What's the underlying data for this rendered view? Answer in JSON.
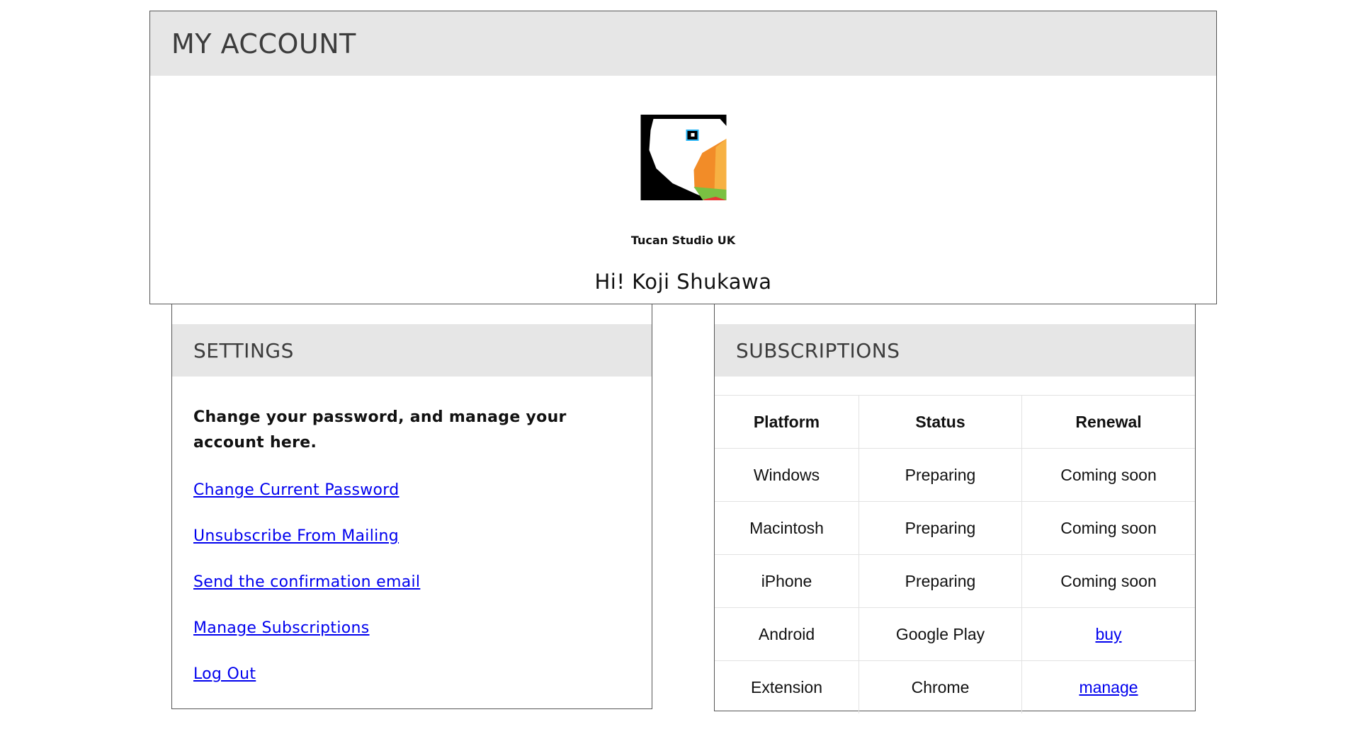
{
  "account": {
    "title": "MY ACCOUNT",
    "company_name": "Tucan Studio UK",
    "greeting": "Hi! Koji Shukawa",
    "logo_icon": "toucan-logo-icon"
  },
  "settings": {
    "title": "SETTINGS",
    "description": "Change your password, and manage your account here.",
    "links": [
      "Change Current Password",
      "Unsubscribe From Mailing",
      "Send the confirmation email",
      "Manage Subscriptions",
      "Log Out"
    ]
  },
  "subscriptions": {
    "title": "SUBSCRIPTIONS",
    "columns": [
      "Platform",
      "Status",
      "Renewal"
    ],
    "rows": [
      [
        "Windows",
        "Preparing",
        "Coming soon"
      ],
      [
        "Macintosh",
        "Preparing",
        "Coming soon"
      ],
      [
        "iPhone",
        "Preparing",
        "Coming soon"
      ],
      [
        "Android",
        "Google Play",
        "buy"
      ],
      [
        "Extension",
        "Chrome",
        "manage"
      ]
    ]
  },
  "colors": {
    "header_bg": "#e6e6e6",
    "header_text": "#3c3c3c",
    "link": "#0000ee",
    "border": "#555555",
    "logo_orange": "#f28c28",
    "logo_light_orange": "#f7b143",
    "logo_green": "#7ac142",
    "logo_red": "#e53935",
    "logo_eye": "#29b6f6"
  }
}
